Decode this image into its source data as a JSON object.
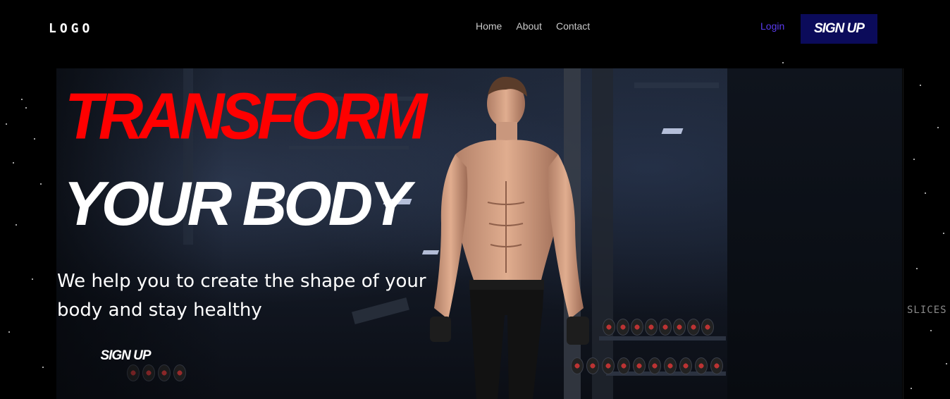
{
  "header": {
    "logo": "LOGO",
    "nav": [
      {
        "label": "Home"
      },
      {
        "label": "About"
      },
      {
        "label": "Contact"
      }
    ],
    "login_label": "Login",
    "signup_label": "SIGN UP"
  },
  "hero": {
    "title_line1": "TRANSFORM",
    "title_line2": "YOUR BODY",
    "subtitle": "We help you to create the shape of your body and stay healthy",
    "cta_label": "SIGN UP"
  },
  "side_label": "SLICES",
  "colors": {
    "background": "#000000",
    "title_accent": "#ff0000",
    "login_link": "#5a3bf0",
    "signup_button": "#0b0b5a"
  },
  "icons": [
    "athlete-image",
    "gym-background-image"
  ]
}
